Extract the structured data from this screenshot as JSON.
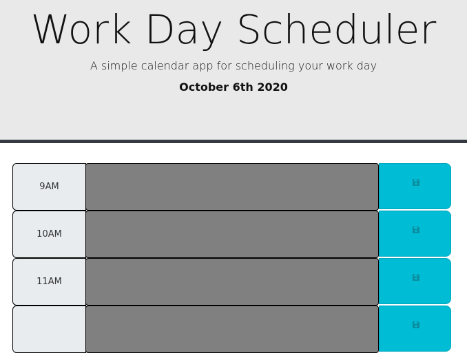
{
  "header": {
    "title": "Work Day Scheduler",
    "subtitle": "A simple calendar app for scheduling your work day",
    "date": "October 6th 2020"
  },
  "rows": [
    {
      "hour": "9AM",
      "description": "",
      "save_icon": "floppy-disk-icon"
    },
    {
      "hour": "10AM",
      "description": "",
      "save_icon": "floppy-disk-icon"
    },
    {
      "hour": "11AM",
      "description": "",
      "save_icon": "floppy-disk-icon"
    },
    {
      "hour": "",
      "description": "",
      "save_icon": "floppy-disk-icon"
    }
  ],
  "colors": {
    "header_bg": "#e9e9e9",
    "header_border": "#343a40",
    "hour_bg": "#e9ecef",
    "past_block": "#808080",
    "save_button": "#00bcd4"
  }
}
